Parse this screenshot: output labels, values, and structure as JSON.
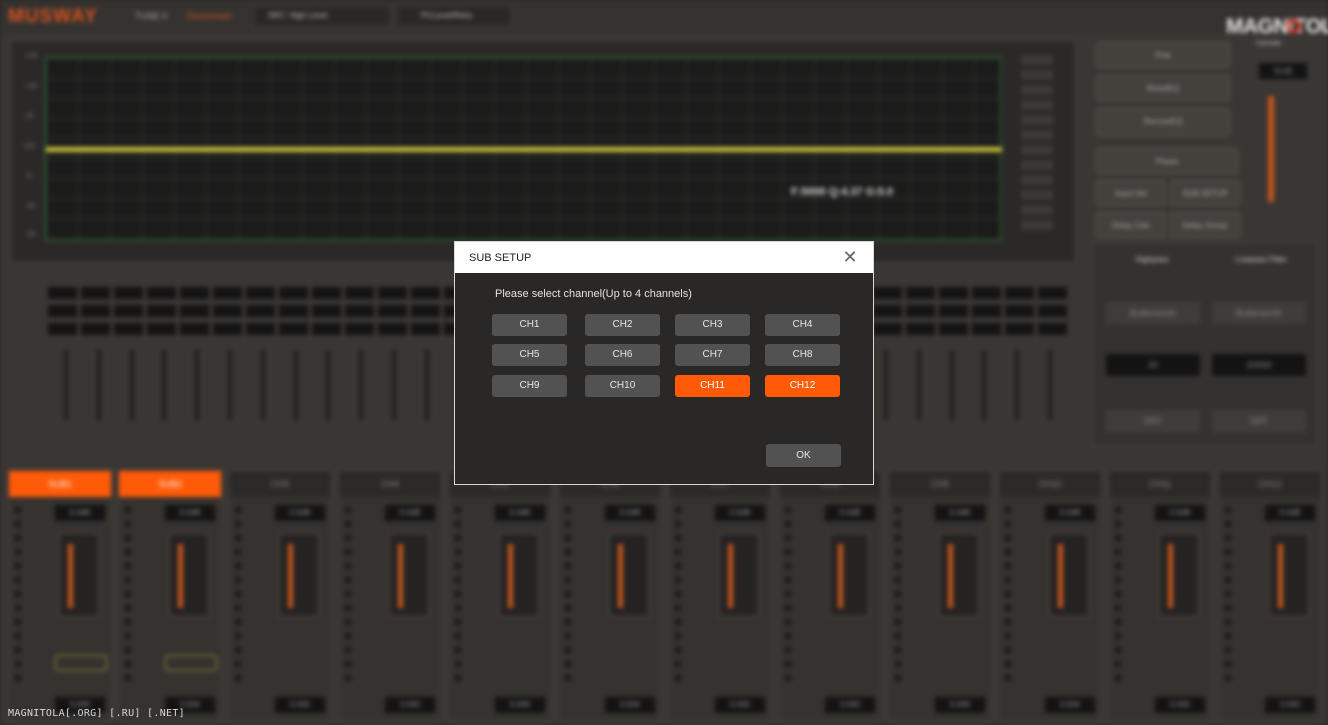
{
  "background": {
    "logo": "MUSWAY",
    "logo_sub": "TUNE II",
    "logo_link": "Disconnect",
    "input_select": "SRC: High Level",
    "preset_select": "PCLevel/Retry",
    "graph_readout": "F:5000 Q:4.37 G:0.0",
    "y_ticks": [
      "+15",
      "+10",
      "+5",
      "0.0",
      "-5",
      "-10",
      "-15"
    ],
    "right_buttons": [
      "Pink",
      "ResetEQ",
      "RecoveEQ",
      "Phase",
      "Input Sel",
      "SUB SETUP",
      "Delay Calc",
      "Delay Group"
    ],
    "filter_tabs": [
      "Highpass",
      "Lowpass Filter"
    ],
    "filter_type": [
      "Butterworth",
      "Butterworth"
    ],
    "filter_freq": [
      "20",
      "20000"
    ],
    "filter_slope": [
      "OFF",
      "OFF"
    ],
    "master_label": "SUB",
    "channels": [
      {
        "label": "SUB1",
        "active": true,
        "gain": "0.0dB",
        "value": "0.000"
      },
      {
        "label": "SUB2",
        "active": true,
        "gain": "0.0dB",
        "value": "0.000"
      },
      {
        "label": "CH3",
        "active": false,
        "gain": "0.0dB",
        "value": "0.000"
      },
      {
        "label": "CH4",
        "active": false,
        "gain": "0.0dB",
        "value": "0.000"
      },
      {
        "label": "CH5",
        "active": false,
        "gain": "0.0dB",
        "value": "0.000"
      },
      {
        "label": "CH6",
        "active": false,
        "gain": "0.0dB",
        "value": "0.000"
      },
      {
        "label": "CH7",
        "active": false,
        "gain": "0.0dB",
        "value": "0.000"
      },
      {
        "label": "CH8",
        "active": false,
        "gain": "0.0dB",
        "value": "0.000"
      },
      {
        "label": "CH9",
        "active": false,
        "gain": "0.0dB",
        "value": "0.000"
      },
      {
        "label": "CH10",
        "active": false,
        "gain": "0.0dB",
        "value": "0.000"
      },
      {
        "label": "CH11",
        "active": false,
        "gain": "0.0dB",
        "value": "0.000"
      },
      {
        "label": "CH12",
        "active": false,
        "gain": "0.0dB",
        "value": "0.000"
      }
    ]
  },
  "watermark": {
    "brand": "MAGNITOLA",
    "brand_sub": "CarAudio",
    "footer": "MAGNITOLA[.ORG] [.RU] [.NET]"
  },
  "dialog": {
    "title": "SUB SETUP",
    "close_glyph": "✕",
    "prompt": "Please select channel(Up to 4 channels)",
    "channels": [
      {
        "label": "CH1",
        "selected": false
      },
      {
        "label": "CH2",
        "selected": false
      },
      {
        "label": "CH3",
        "selected": false
      },
      {
        "label": "CH4",
        "selected": false
      },
      {
        "label": "CH5",
        "selected": false
      },
      {
        "label": "CH6",
        "selected": false
      },
      {
        "label": "CH7",
        "selected": false
      },
      {
        "label": "CH8",
        "selected": false
      },
      {
        "label": "CH9",
        "selected": false
      },
      {
        "label": "CH10",
        "selected": false
      },
      {
        "label": "CH11",
        "selected": true
      },
      {
        "label": "CH12",
        "selected": true
      }
    ],
    "ok_label": "OK",
    "accent_color": "#ff5a08"
  }
}
